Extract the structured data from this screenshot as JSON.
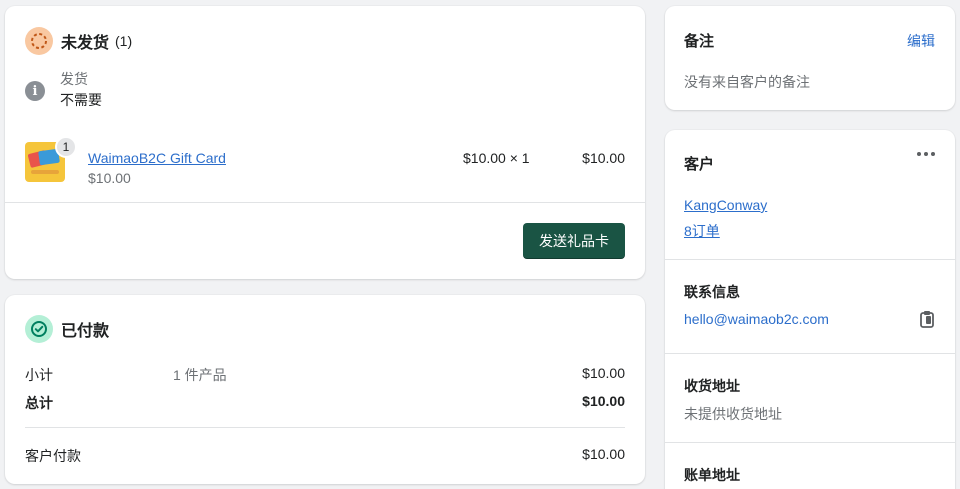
{
  "unfulfilled": {
    "title": "未发货",
    "count": "(1)",
    "shipping_label": "发货",
    "shipping_value": "不需要",
    "item": {
      "quantity": "1",
      "name": "WaimaoB2C Gift Card",
      "price": "$10.00",
      "unit_price_qty": "$10.00 × 1",
      "total": "$10.00"
    },
    "send_button": "发送礼品卡"
  },
  "paid": {
    "title": "已付款",
    "subtotal_label": "小计",
    "subtotal_items": "1 件产品",
    "subtotal_amount": "$10.00",
    "total_label": "总计",
    "total_amount": "$10.00",
    "customer_paid_label": "客户付款",
    "customer_paid_amount": "$10.00"
  },
  "notes": {
    "title": "备注",
    "edit_link": "编辑",
    "empty_text": "没有来自客户的备注"
  },
  "customer": {
    "title": "客户",
    "name": "KangConway",
    "orders": "8订单",
    "contact_title": "联系信息",
    "email": "hello@waimaob2c.com",
    "shipping_title": "收货地址",
    "shipping_empty": "未提供收货地址",
    "billing_title": "账单地址"
  },
  "colors": {
    "primary_button": "#1a5444",
    "link": "#2c6ecb",
    "unfulfilled_badge": "#f9c8a1",
    "paid_badge": "#b4efd6"
  }
}
